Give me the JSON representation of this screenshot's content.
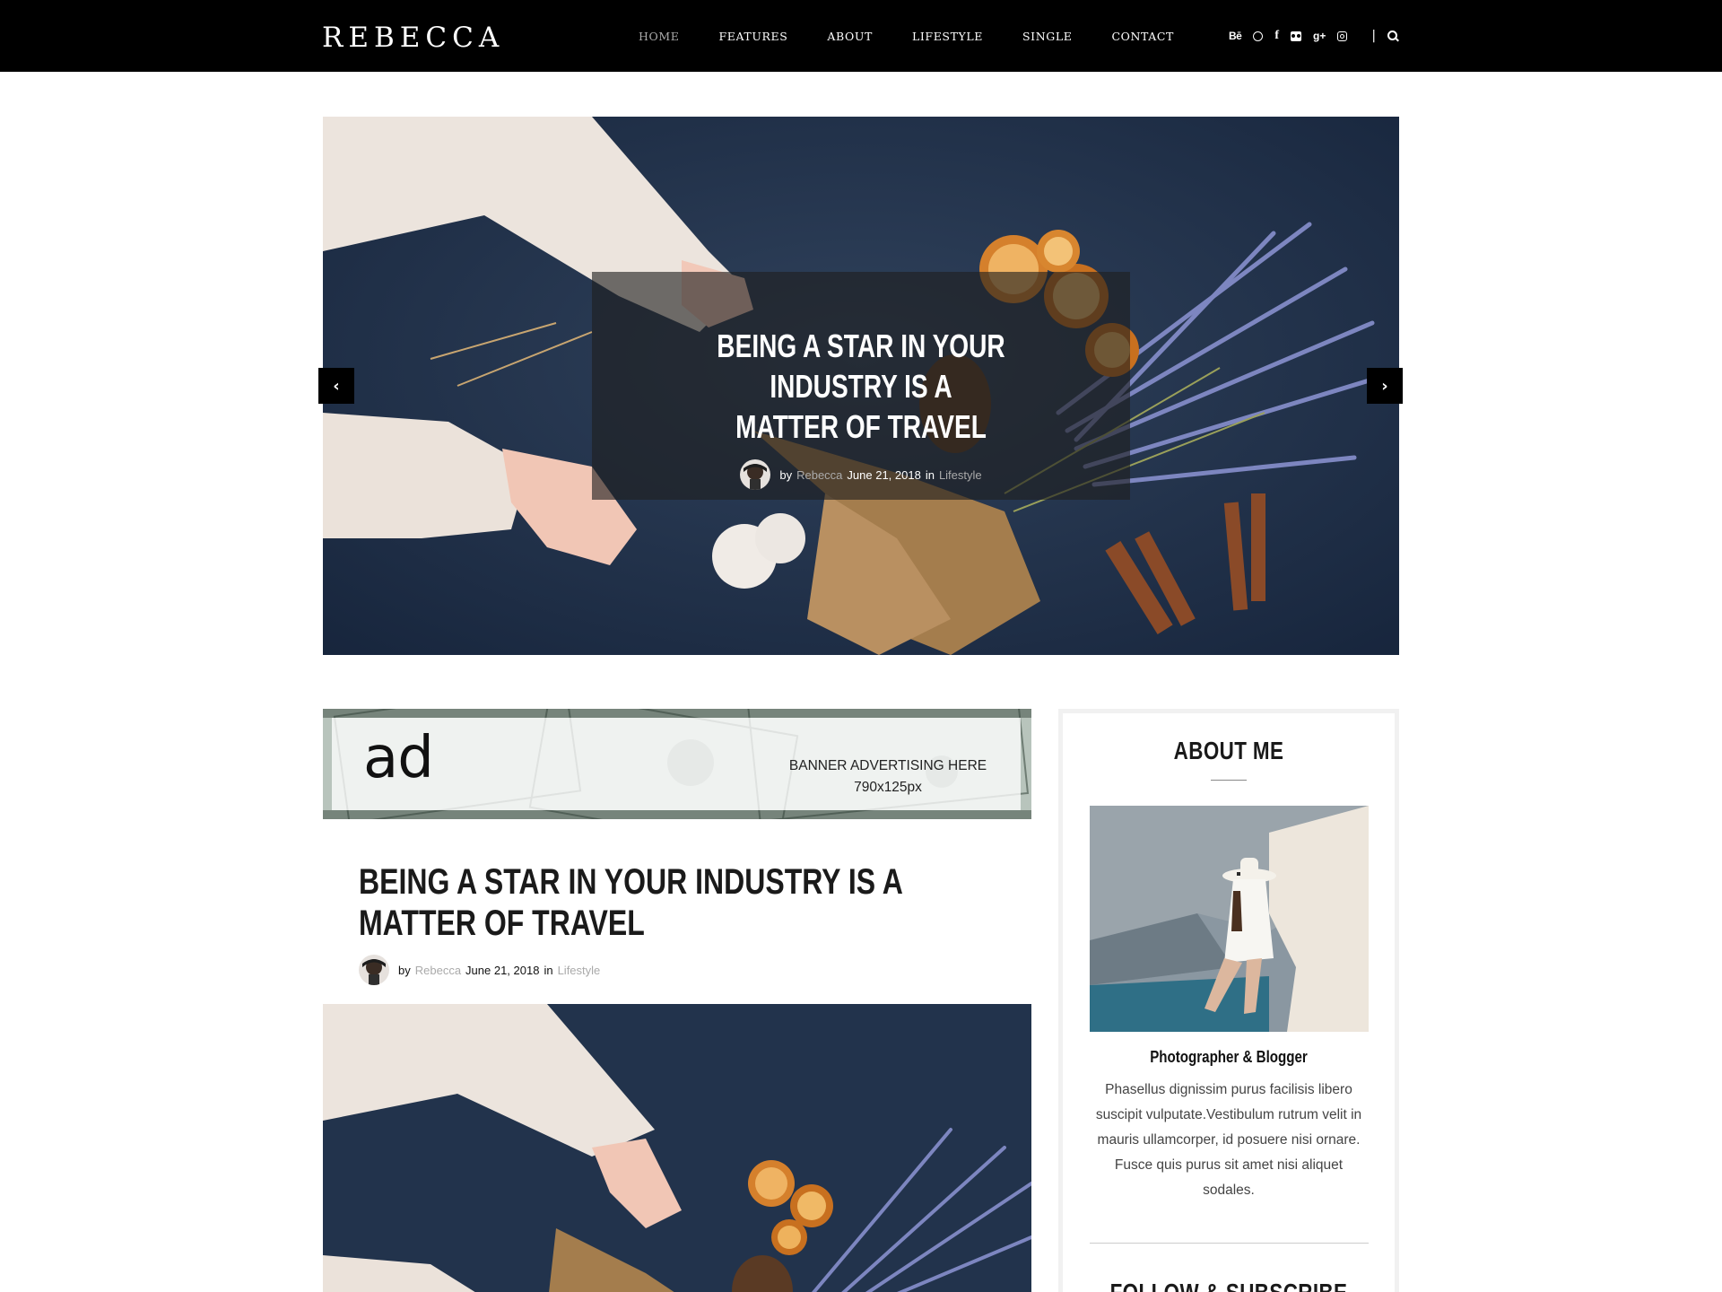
{
  "site": {
    "logo": "REBECCA",
    "nav": [
      {
        "label": "HOME",
        "active": true
      },
      {
        "label": "FEATURES"
      },
      {
        "label": "ABOUT"
      },
      {
        "label": "LIFESTYLE"
      },
      {
        "label": "SINGLE"
      },
      {
        "label": "CONTACT"
      }
    ],
    "social_icons": [
      "behance-icon",
      "dribbble-icon",
      "facebook-icon",
      "flickr-icon",
      "google-plus-icon",
      "instagram-icon"
    ],
    "separator": "|",
    "colors": {
      "header_bg": "#000000",
      "muted_text": "#aaaaaa",
      "accent_link": "#999999"
    }
  },
  "hero": {
    "title": "BEING A STAR IN YOUR INDUSTRY IS A\nMATTER OF TRAVEL",
    "by": "by",
    "author": "Rebecca",
    "date": "June 21, 2018",
    "in": "in",
    "category": "Lifestyle",
    "prev_icon": "chevron-left-icon",
    "next_icon": "chevron-right-icon"
  },
  "ad": {
    "word": "ad",
    "line1": "BANNER ADVERTISING HERE",
    "line2": "790x125px"
  },
  "post": {
    "title": "BEING A STAR IN YOUR INDUSTRY IS A MATTER OF TRAVEL",
    "by": "by",
    "author": "Rebecca",
    "date": "June 21, 2018",
    "in": "in",
    "category": "Lifestyle"
  },
  "sidebar": {
    "about_title": "ABOUT ME",
    "role": "Photographer & Blogger",
    "bio": "Phasellus dignissim purus facilisis libero suscipit vulputate.Vestibulum rutrum velit in mauris ullamcorper, id posuere nisi ornare. Fusce quis purus sit amet nisi aliquet sodales.",
    "follow_title": "FOLLOW & SUBSCRIBE"
  }
}
